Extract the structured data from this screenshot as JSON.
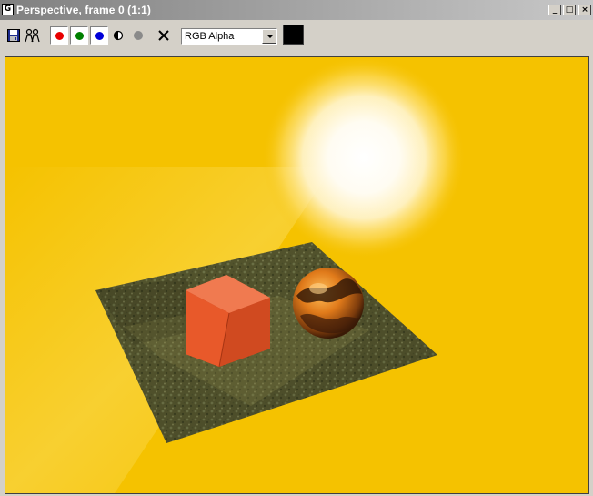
{
  "window": {
    "icon_glyph": "G",
    "title": "Perspective, frame 0 (1:1)",
    "buttons": {
      "minimize_glyph": "_",
      "maximize_glyph": "□",
      "close_glyph": "×"
    }
  },
  "toolbar": {
    "items": [
      "save-icon",
      "clone-icon",
      "red-channel",
      "green-channel",
      "blue-channel",
      "mono-toggle",
      "alpha-channel",
      "clear-icon"
    ],
    "channel_colors": {
      "red": "#e80000",
      "green": "#008000",
      "blue": "#0000d8"
    },
    "display_mode": {
      "selected": "RGB Alpha"
    },
    "swatch_color": "#000000"
  },
  "render": {
    "background_color": "#f5c200",
    "objects": [
      "sun-glow",
      "ground-plane",
      "red-box",
      "marble-sphere"
    ]
  }
}
